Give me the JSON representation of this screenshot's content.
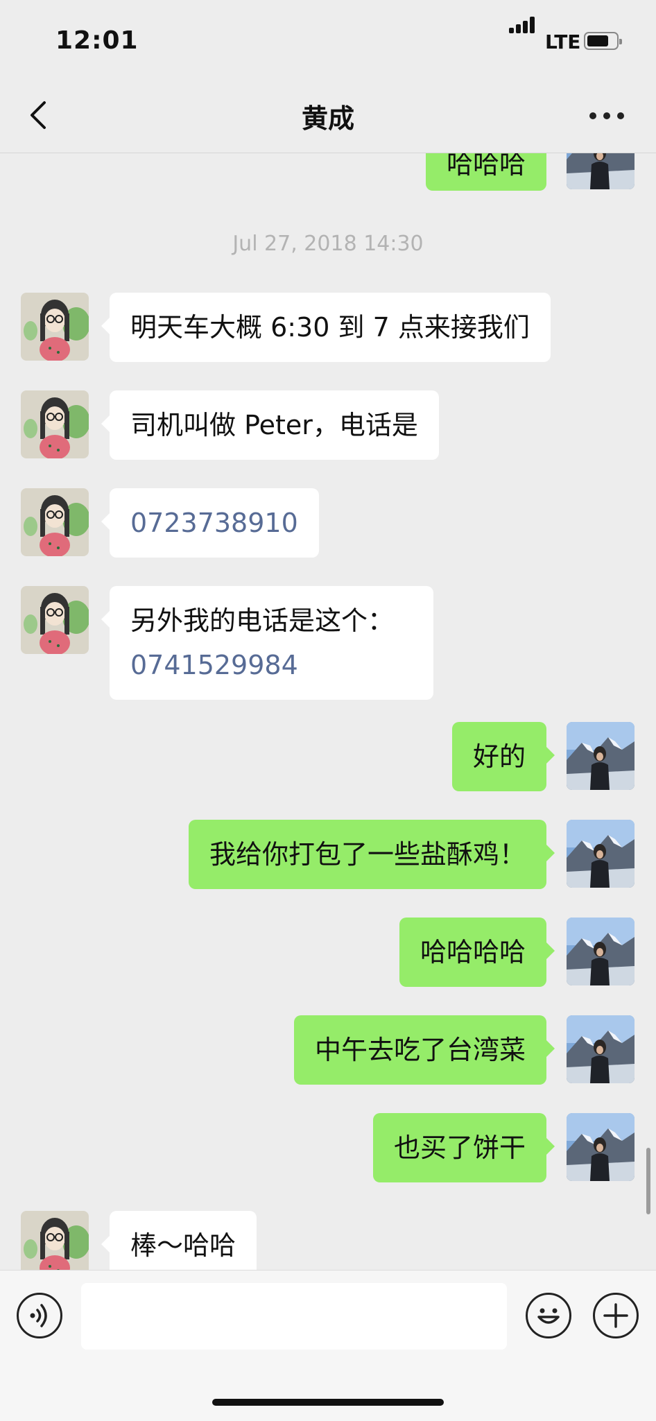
{
  "status": {
    "time": "12:01",
    "network": "LTE"
  },
  "header": {
    "title": "黄成"
  },
  "chat": {
    "partial_top_message": "哈哈哈",
    "timestamp": "Jul 27, 2018 14:30",
    "messages": [
      {
        "side": "in",
        "text": "明天车大概 6:30 到 7 点来接我们"
      },
      {
        "side": "in",
        "text": "司机叫做 Peter，电话是"
      },
      {
        "side": "in",
        "text": "0723738910",
        "is_link": true
      },
      {
        "side": "in",
        "line1": "另外我的电话是这个：",
        "line2": "0741529984"
      },
      {
        "side": "out",
        "text": "好的"
      },
      {
        "side": "out",
        "text": "我给你打包了一些盐酥鸡！"
      },
      {
        "side": "out",
        "text": "哈哈哈哈"
      },
      {
        "side": "out",
        "text": "中午去吃了台湾菜"
      },
      {
        "side": "out",
        "text": "也买了饼干"
      },
      {
        "side": "in",
        "text": "棒～哈哈"
      }
    ]
  },
  "input": {
    "value": "",
    "placeholder": ""
  },
  "icons": {
    "back": "chevron-left-icon",
    "more": "more-dots-icon",
    "voice": "voice-icon",
    "emoji": "emoji-icon",
    "plus": "plus-icon"
  },
  "colors": {
    "background": "#ededed",
    "outgoing_bubble": "#95ec69",
    "incoming_bubble": "#ffffff",
    "link": "#576b95",
    "timestamp": "#b3b3b3"
  }
}
